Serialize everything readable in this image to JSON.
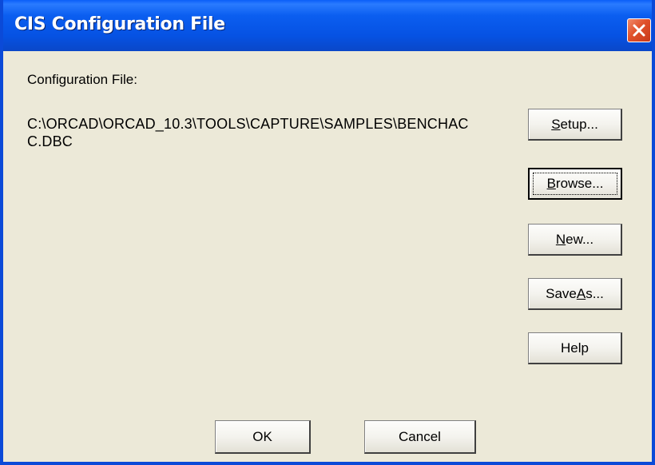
{
  "window": {
    "title": "CIS Configuration File"
  },
  "dialog": {
    "config_label": "Configuration File:",
    "config_path": "C:\\ORCAD\\ORCAD_10.3\\TOOLS\\CAPTURE\\SAMPLES\\BENCHACC.DBC"
  },
  "buttons": {
    "setup": {
      "before": "",
      "mnemonic": "S",
      "after": "etup..."
    },
    "browse": {
      "before": "",
      "mnemonic": "B",
      "after": "rowse..."
    },
    "new": {
      "before": "",
      "mnemonic": "N",
      "after": "ew..."
    },
    "save_as": {
      "before": "Save ",
      "mnemonic": "A",
      "after": "s..."
    },
    "help": {
      "before": "Help",
      "mnemonic": "",
      "after": ""
    },
    "ok": {
      "before": "OK",
      "mnemonic": "",
      "after": ""
    },
    "cancel": {
      "before": "Cancel",
      "mnemonic": "",
      "after": ""
    }
  },
  "colors": {
    "titlebar": "#0652e3",
    "client_bg": "#ece9d8",
    "close_button": "#e0512b"
  },
  "icons": {
    "close": "close-icon"
  }
}
